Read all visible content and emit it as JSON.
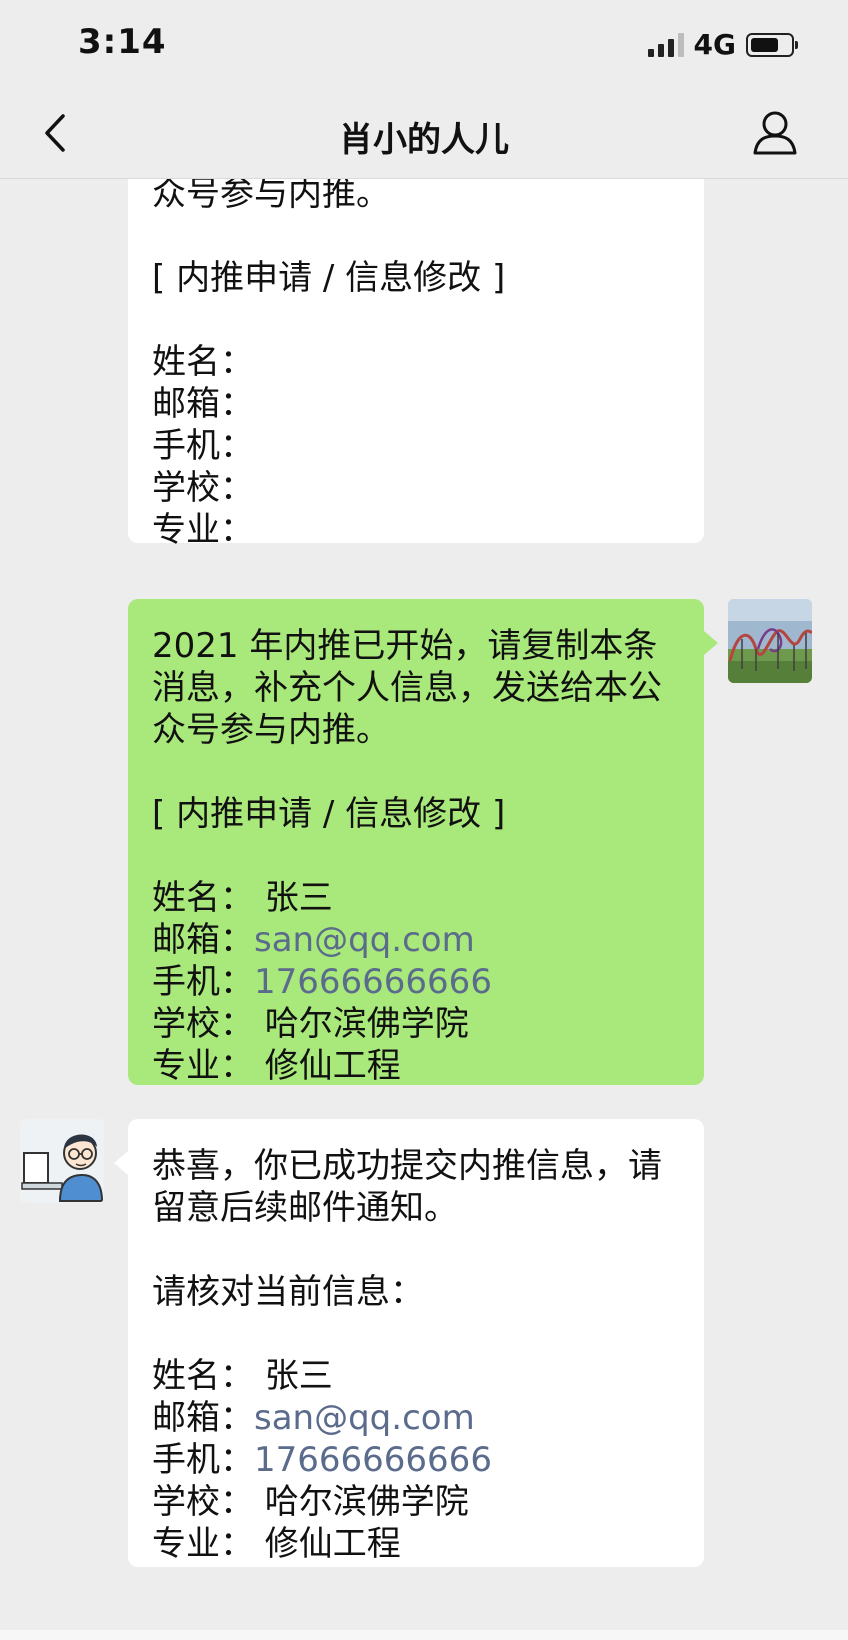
{
  "status_bar": {
    "time": "3:14",
    "network": "4G"
  },
  "nav": {
    "title": "肖小的人儿"
  },
  "messages": [
    {
      "lines": [
        "众号参与内推。",
        "",
        "[ 内推申请 / 信息修改 ]",
        "",
        "姓名：",
        "邮箱：",
        "手机：",
        "学校：",
        "专业："
      ]
    },
    {
      "lines": [
        "2021 年内推已开始，请复制本条",
        "消息，补充个人信息，发送给本公",
        "众号参与内推。",
        "",
        "[ 内推申请 / 信息修改 ]",
        "",
        "姓名：  张三",
        "邮箱：",
        "手机：",
        "学校：  哈尔滨佛学院",
        "专业：  修仙工程"
      ],
      "email": "san@qq.com",
      "phone": "17666666666"
    },
    {
      "lines": [
        "恭喜，你已成功提交内推信息，请",
        "留意后续邮件通知。",
        "",
        "请核对当前信息：",
        "",
        "姓名：  张三",
        "邮箱：",
        "手机：",
        "学校：  哈尔滨佛学院",
        "专业：  修仙工程"
      ],
      "email": "san@qq.com",
      "phone": "17666666666"
    }
  ],
  "colors": {
    "background": "#ededed",
    "sent_bubble": "#a9e87a",
    "received_bubble": "#ffffff",
    "link": "#5b6b8c"
  },
  "icons": {
    "back": "chevron-left-icon",
    "profile": "person-icon"
  }
}
